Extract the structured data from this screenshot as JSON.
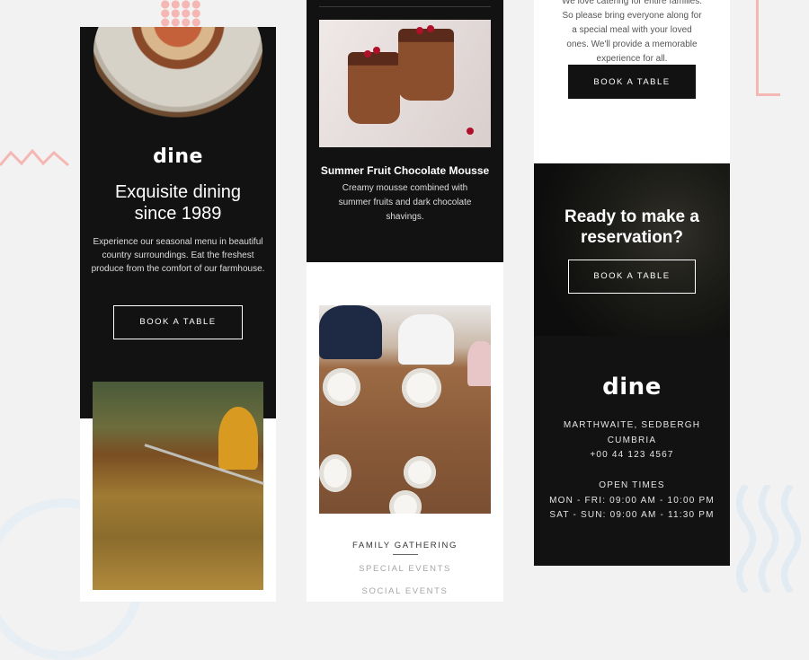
{
  "colors": {
    "accent": "#f5b7b4",
    "dark": "#121212"
  },
  "col1": {
    "logo": "dine",
    "headline_line1": "Exquisite dining",
    "headline_line2": "since 1989",
    "description": "Experience our seasonal menu in beautiful country surroundings. Eat the freshest produce from the comfort of our farmhouse.",
    "cta": "BOOK A TABLE"
  },
  "col2": {
    "dish_title": "Summer Fruit Chocolate Mousse",
    "dish_description": "Creamy mousse combined with summer fruits and dark chocolate shavings.",
    "menu": [
      "FAMILY GATHERING",
      "SPECIAL EVENTS",
      "SOCIAL EVENTS"
    ]
  },
  "col3": {
    "intro": "We love catering for entire families. So please bring everyone along for a special meal with your loved ones. We'll provide a memorable experience for all.",
    "cta_top": "BOOK A TABLE",
    "reserve_line1": "Ready to make a",
    "reserve_line2": "reservation?",
    "cta_reserve": "BOOK A TABLE",
    "logo": "dine",
    "address_line1": "MARTHWAITE, SEDBERGH",
    "address_line2": "CUMBRIA",
    "phone": "+00 44 123 4567",
    "open_label": "OPEN TIMES",
    "hours_weekday": "MON - FRI: 09:00 AM - 10:00 PM",
    "hours_weekend": "SAT - SUN: 09:00 AM - 11:30 PM"
  }
}
